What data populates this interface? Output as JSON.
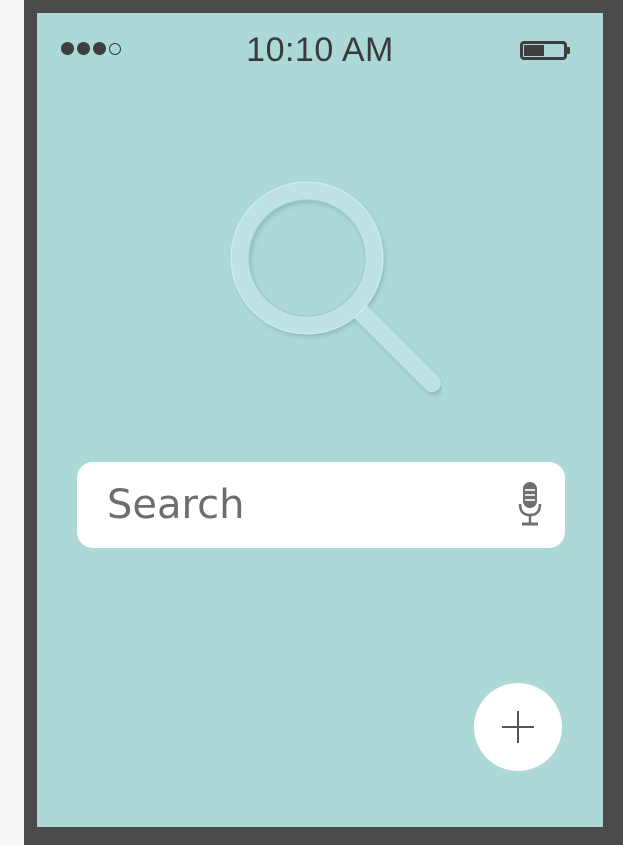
{
  "status_bar": {
    "time": "10:10 AM",
    "signal_bars_filled": 3,
    "signal_bars_total": 4,
    "battery_icon": "battery-icon",
    "battery_level": 0.45
  },
  "hero": {
    "icon": "magnifying-glass-icon"
  },
  "search": {
    "placeholder": "Search",
    "value": "",
    "mic_icon": "microphone-icon"
  },
  "fab": {
    "icon": "plus-icon"
  },
  "colors": {
    "screen_background": "#add8d8",
    "frame": "#4a4a4a",
    "icon_dark": "#3e3e3e",
    "surface": "#ffffff"
  }
}
